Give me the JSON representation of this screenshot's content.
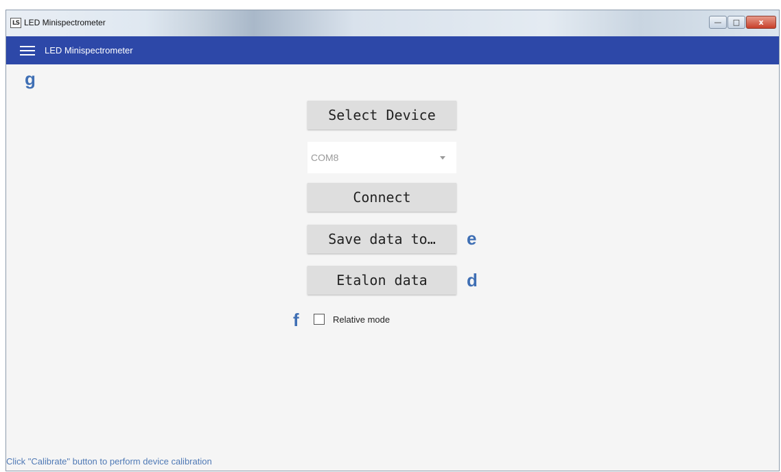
{
  "window": {
    "title": "LED Minispectrometer",
    "icon_text": "LS"
  },
  "window_controls": {
    "minimize": "—",
    "maximize": "□",
    "close": "x"
  },
  "appbar": {
    "title": "LED Minispectrometer"
  },
  "buttons": {
    "select_device": "Select Device",
    "connect": "Connect",
    "save_data": "Save data to…",
    "etalon_data": "Etalon data"
  },
  "port_select": {
    "value": "COM8"
  },
  "relative_mode": {
    "label": "Relative mode",
    "checked": false
  },
  "status": {
    "text": "Click \"Calibrate\" button to perform device calibration"
  },
  "annotations": {
    "g": "g",
    "e": "e",
    "d": "d",
    "f": "f"
  },
  "colors": {
    "appbar": "#2d48a8",
    "annotation": "#3f6fb4",
    "status": "#4f79b5"
  }
}
